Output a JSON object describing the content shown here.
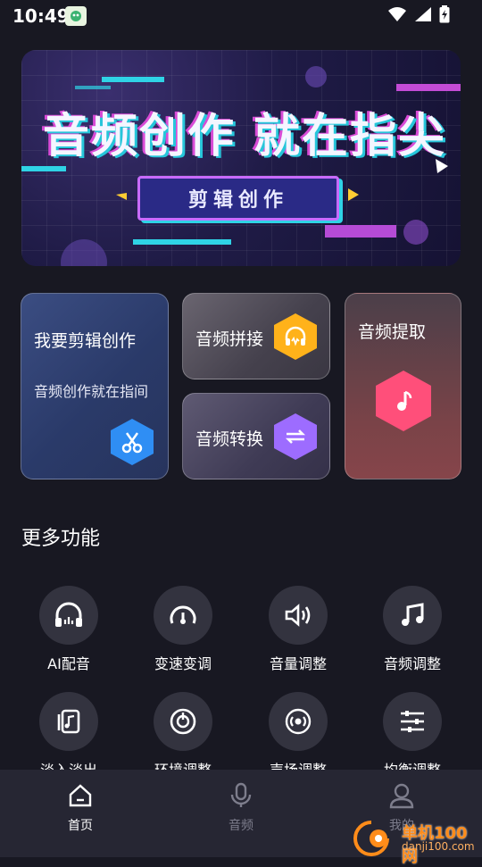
{
  "status_bar": {
    "time": "10:49",
    "app_icon": "app-notification-icon"
  },
  "banner": {
    "headline": "音频创作 就在指尖",
    "button_label": "剪辑创作",
    "colors": {
      "cyan": "#26c6da",
      "magenta": "#d84bd6",
      "purple": "#c86bff"
    }
  },
  "cards": {
    "edit": {
      "title": "我要剪辑创作",
      "subtitle": "音频创作就在指间",
      "icon": "scissors-icon",
      "icon_color": "#2f8ef4"
    },
    "splice": {
      "title": "音频拼接",
      "icon": "headphones-icon",
      "icon_color": "#ffb21a"
    },
    "convert": {
      "title": "音频转换",
      "icon": "swap-arrows-icon",
      "icon_color": "#9d6cff"
    },
    "extract": {
      "title": "音频提取",
      "icon": "music-note-icon",
      "icon_color": "#ff4f7a"
    }
  },
  "more_section": {
    "title": "更多功能",
    "tools": [
      {
        "label": "AI配音",
        "icon": "headphones-icon"
      },
      {
        "label": "变速变调",
        "icon": "speedometer-icon"
      },
      {
        "label": "音量调整",
        "icon": "volume-icon"
      },
      {
        "label": "音频调整",
        "icon": "music-notes-icon"
      },
      {
        "label": "淡入淡出",
        "icon": "music-file-icon"
      },
      {
        "label": "环境调整",
        "icon": "dial-icon"
      },
      {
        "label": "声场调整",
        "icon": "broadcast-icon"
      },
      {
        "label": "均衡调整",
        "icon": "equalizer-icon"
      }
    ]
  },
  "bottom_nav": {
    "items": [
      {
        "label": "首页",
        "icon": "home-icon",
        "active": true
      },
      {
        "label": "音频",
        "icon": "microphone-icon",
        "active": false
      },
      {
        "label": "我的",
        "icon": "user-icon",
        "active": false
      }
    ]
  },
  "watermark": {
    "text": "单机100网",
    "url": "danji100.com"
  }
}
